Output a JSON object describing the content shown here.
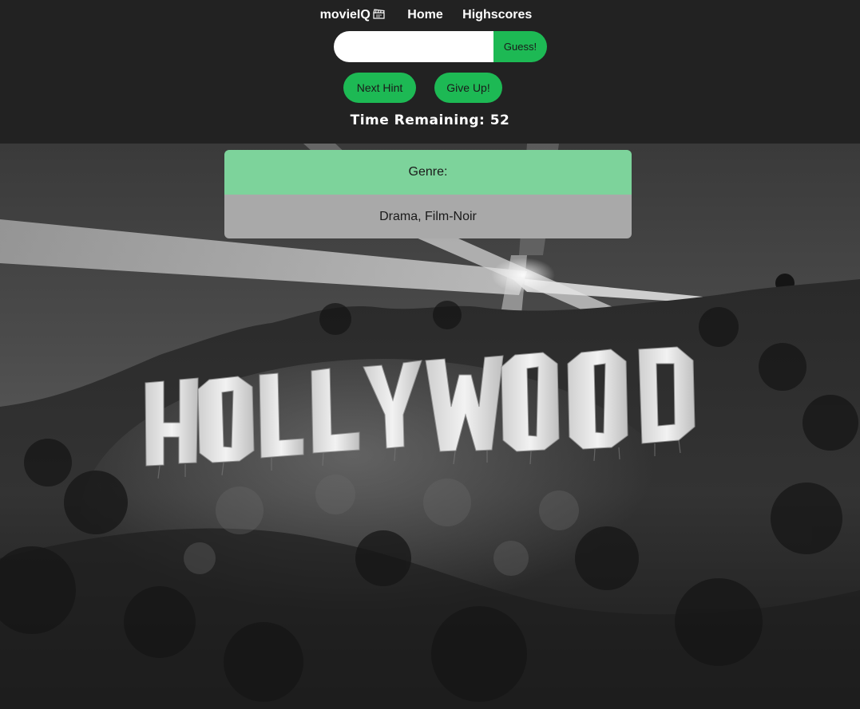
{
  "nav": {
    "brand": "movieIQ",
    "brand_icon": "clapperboard-icon",
    "home_label": "Home",
    "highscores_label": "Highscores"
  },
  "guess": {
    "input_value": "",
    "input_placeholder": "",
    "button_label": "Guess!"
  },
  "actions": {
    "next_hint_label": "Next Hint",
    "give_up_label": "Give Up!"
  },
  "timer": {
    "text": "Time Remaining: 52"
  },
  "hint": {
    "label": "Genre:",
    "value": "Drama, Film-Noir"
  },
  "colors": {
    "accent": "#1db954",
    "header_bg": "#222222",
    "hint_label_bg": "#7dd39b",
    "hint_value_bg": "#a9a9a9"
  }
}
